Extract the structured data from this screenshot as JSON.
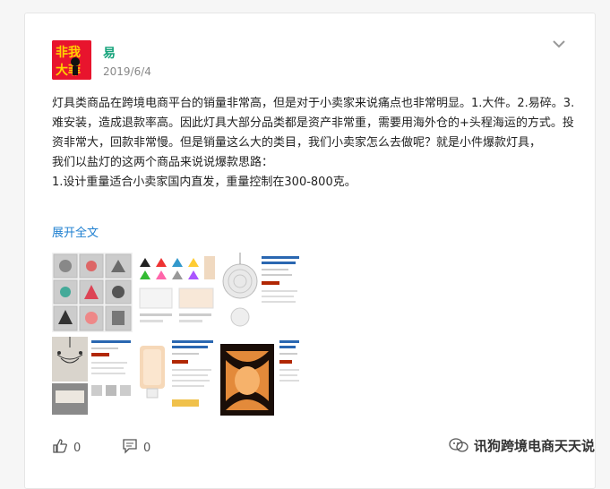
{
  "post": {
    "author": "易",
    "date": "2019/6/4",
    "avatar_text": "非我大菲",
    "paragraphs": [
      "灯具类商品在跨境电商平台的销量非常高，但是对于小卖家来说痛点也非常明显。1.大件。2.易碎。3.难安装，造成退款率高。因此灯具大部分品类都是资产非常重，需要用海外仓的+头程海运的方式。投资非常大，回款非常慢。但是销量这么大的类目，我们小卖家怎么去做呢？就是小件爆款灯具，",
      "我们以盐灯的这两个商品来说说爆款思路：",
      "1.设计重量适合小卖家国内直发，重量控制在300-800克。"
    ],
    "expand_label": "展开全文",
    "thumbnails": [
      "pendant-lights-grid",
      "color-lamp-shades-listing",
      "crystal-ball-lamp-listing",
      "chandelier-room-listing",
      "salt-lamp-nightlight-listing",
      "salt-lamp-wooden-basket"
    ]
  },
  "footer": {
    "likes": "0",
    "comments": "0",
    "watermark": "讯狗跨境电商天天说"
  },
  "colors": {
    "author": "#14a37a",
    "link": "#1e7fd0",
    "avatar_bg": "#e8142d"
  }
}
